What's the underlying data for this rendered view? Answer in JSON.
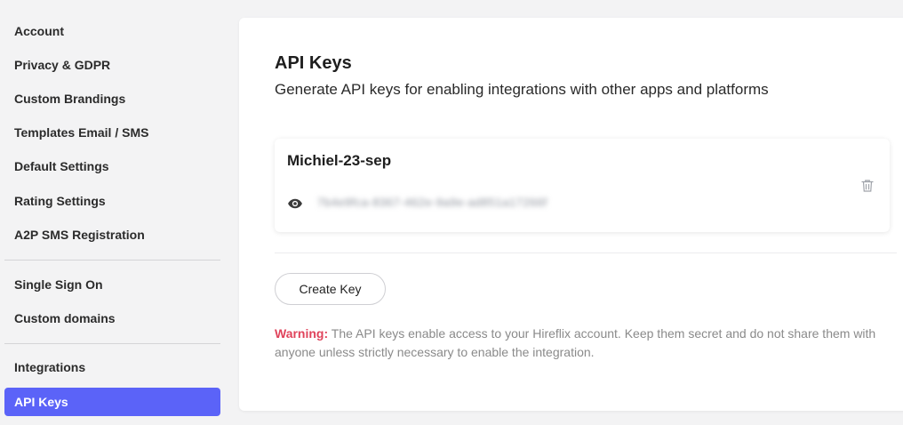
{
  "sidebar": {
    "items": [
      {
        "label": "Account"
      },
      {
        "label": "Privacy & GDPR"
      },
      {
        "label": "Custom Brandings"
      },
      {
        "label": "Templates Email / SMS"
      },
      {
        "label": "Default Settings"
      },
      {
        "label": "Rating Settings"
      },
      {
        "label": "A2P SMS Registration"
      },
      {
        "label": "Single Sign On"
      },
      {
        "label": "Custom domains"
      },
      {
        "label": "Integrations"
      },
      {
        "label": "API Keys",
        "active": true
      }
    ],
    "active_color": "#5b63f8"
  },
  "main": {
    "title": "API Keys",
    "subtitle": "Generate API keys for enabling integrations with other apps and platforms",
    "keys": [
      {
        "name": "Michiel-23-sep",
        "masked_value": "7b4e9fca-8367-462e-9a9e-ad851a17266f",
        "reveal_icon": "eye-icon",
        "delete_icon": "trash-icon"
      }
    ],
    "create_button_label": "Create Key",
    "warning": {
      "label": "Warning:",
      "text": " The API keys enable access to your Hireflix account. Keep them secret and do not share them with anyone unless strictly necessary to enable the integration.",
      "label_color": "#e0435b"
    }
  }
}
